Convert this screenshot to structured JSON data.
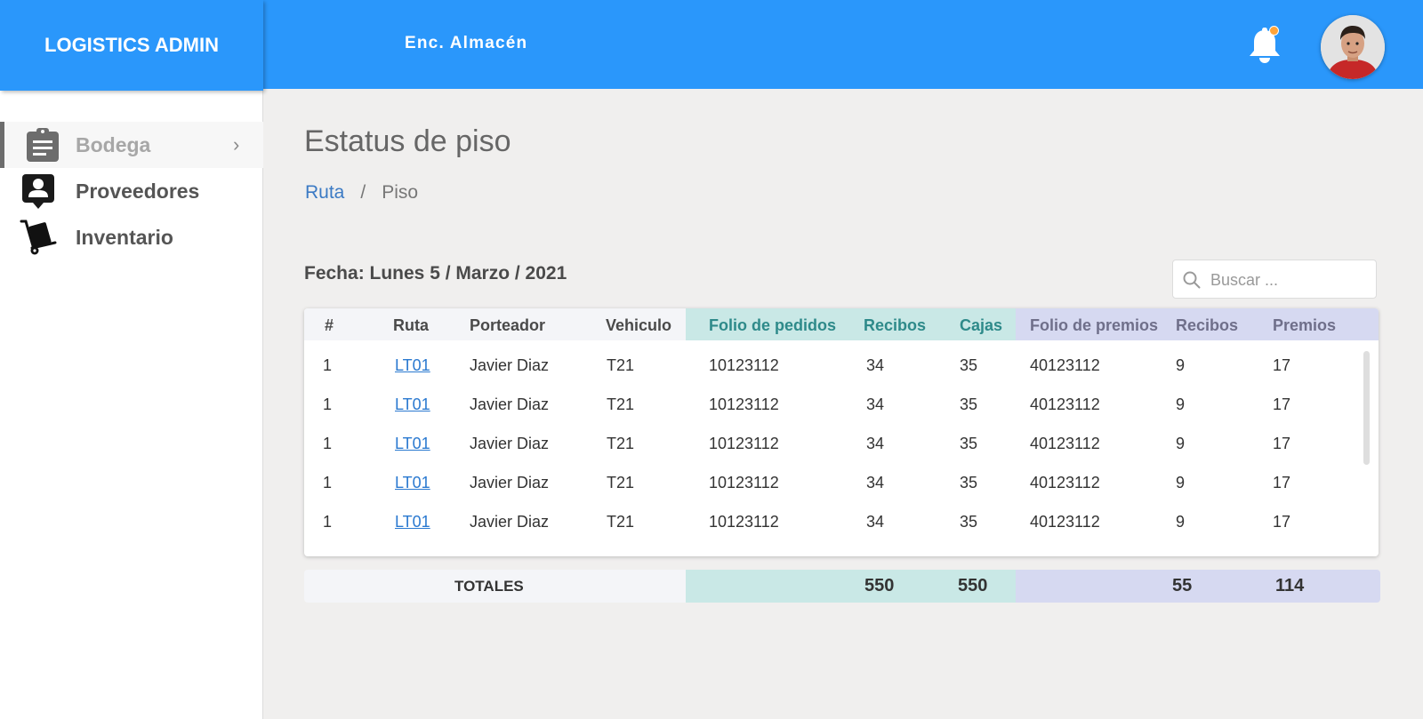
{
  "app": {
    "title": "LOGISTICS ADMIN",
    "role": "Enc. Almacén"
  },
  "colors": {
    "primary": "#2a97fb",
    "notification_dot": "#ffa43a",
    "folio_pedidos_band": "#c9e8e6",
    "folio_premios_band": "#d6d9f1"
  },
  "header": {
    "bell_icon": "bell-icon",
    "avatar": "user-avatar"
  },
  "sidebar": {
    "items": [
      {
        "label": "Bodega",
        "icon": "clipboard-icon",
        "active": true,
        "chevron": "›"
      },
      {
        "label": "Proveedores",
        "icon": "contact-icon"
      },
      {
        "label": "Inventario",
        "icon": "hand-truck-icon"
      }
    ]
  },
  "page": {
    "title": "Estatus de piso",
    "breadcrumb": {
      "link": "Ruta",
      "separator": "/",
      "current": "Piso"
    },
    "date": "Fecha: Lunes 5 / Marzo / 2021"
  },
  "search": {
    "placeholder": "Buscar ...",
    "value": ""
  },
  "table": {
    "headers": [
      "#",
      "Ruta",
      "Porteador",
      "Vehiculo",
      "Folio de pedidos",
      "Recibos",
      "Cajas",
      "Folio de premios",
      "Recibos",
      "Premios"
    ],
    "rows": [
      [
        "1",
        "LT01",
        "Javier Diaz",
        "T21",
        "10123112",
        "34",
        "35",
        "40123112",
        "9",
        "17"
      ],
      [
        "1",
        "LT01",
        "Javier Diaz",
        "T21",
        "10123112",
        "34",
        "35",
        "40123112",
        "9",
        "17"
      ],
      [
        "1",
        "LT01",
        "Javier Diaz",
        "T21",
        "10123112",
        "34",
        "35",
        "40123112",
        "9",
        "17"
      ],
      [
        "1",
        "LT01",
        "Javier Diaz",
        "T21",
        "10123112",
        "34",
        "35",
        "40123112",
        "9",
        "17"
      ],
      [
        "1",
        "LT01",
        "Javier Diaz",
        "T21",
        "10123112",
        "34",
        "35",
        "40123112",
        "9",
        "17"
      ]
    ]
  },
  "totals": {
    "label": "TOTALES",
    "recibos_pedidos": "550",
    "cajas": "550",
    "recibos_premios": "55",
    "premios": "114"
  }
}
